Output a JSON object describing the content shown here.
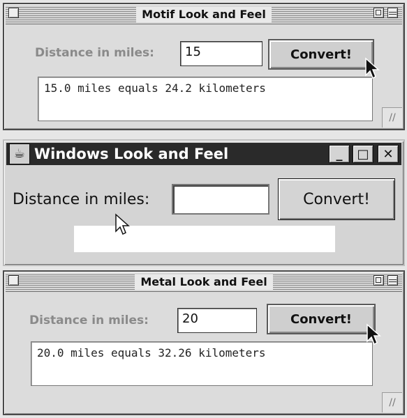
{
  "motif": {
    "title": "Motif Look and Feel",
    "label": "Distance in miles:",
    "input_value": "15",
    "convert_label": "Convert!",
    "result_text": "15.0 miles equals 24.2 kilometers"
  },
  "windows": {
    "title": "Windows Look and Feel",
    "label": "Distance in miles:",
    "input_value": "",
    "convert_label": "Convert!",
    "result_text": "",
    "minimize_glyph": "_",
    "maximize_glyph": "□",
    "close_glyph": "✕"
  },
  "metal": {
    "title": "Metal Look and Feel",
    "label": "Distance in miles:",
    "input_value": "20",
    "convert_label": "Convert!",
    "result_text": "20.0 miles equals 32.26 kilometers"
  },
  "icons": {
    "close": "close-box-icon",
    "zoom": "zoom-box-icon",
    "collapse": "collapse-box-icon",
    "grow": "resize-grip-icon",
    "app": "java-cup-icon",
    "cursor": "arrow-pointer-icon"
  },
  "colors": {
    "window_bg": "#dcdcdc",
    "windows_title_bg": "#2a2a2a",
    "windows_title_text": "#ffffff",
    "label_gray": "#8a8a8a"
  }
}
